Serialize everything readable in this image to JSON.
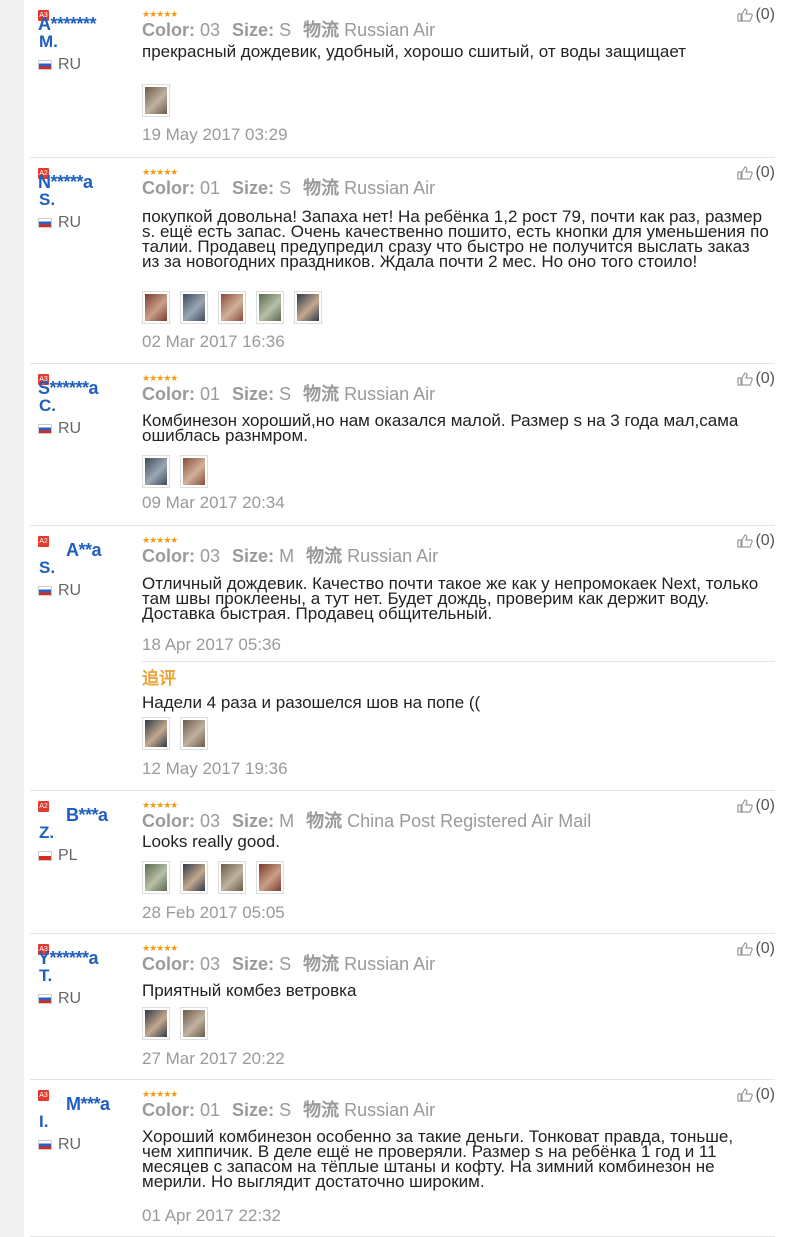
{
  "reviews": [
    {
      "badge": "A3",
      "name": "A*******",
      "initial": "M.",
      "country": "RU",
      "stars": "★★★★★",
      "color_label": "Color:",
      "color": "03",
      "size_label": "Size:",
      "size": "S",
      "logistics_label": "物流",
      "shipping": "Russian Air",
      "comment": "прекрасный дождевик, удобный, хорошо сшитый, от воды защищает",
      "photo_count": 1,
      "date": "19 May 2017 03:29",
      "helpful": "(0)"
    },
    {
      "badge": "A2",
      "name": "N*****a",
      "initial": "S.",
      "country": "RU",
      "stars": "★★★★★",
      "color_label": "Color:",
      "color": "01",
      "size_label": "Size:",
      "size": "S",
      "logistics_label": "物流",
      "shipping": "Russian Air",
      "comment": "покупкой довольна! Запаха нет! На ребёнка 1,2 рост 79, почти как раз, размер s. ещё есть запас. Очень качественно пошито, есть кнопки для уменьшения по талии. Продавец предупредил сразу что быстро не получится выслать заказ из за новогодних праздников. Ждала почти 2 мес. Но оно того стоило!",
      "photo_count": 5,
      "date": "02 Mar 2017 16:36",
      "helpful": "(0)"
    },
    {
      "badge": "A3",
      "name": "S******a",
      "initial": "C.",
      "country": "RU",
      "stars": "★★★★★",
      "color_label": "Color:",
      "color": "01",
      "size_label": "Size:",
      "size": "S",
      "logistics_label": "物流",
      "shipping": "Russian Air",
      "comment": "Комбинезон хороший,но нам оказался малой. Размер s на 3 года мал,сама ошиблась разнмром.",
      "photo_count": 2,
      "date": "09 Mar 2017 20:34",
      "helpful": "(0)"
    },
    {
      "badge": "A2",
      "name": "A**a",
      "initial": "S.",
      "country": "RU",
      "stars": "★★★★★",
      "color_label": "Color:",
      "color": "03",
      "size_label": "Size:",
      "size": "M",
      "logistics_label": "物流",
      "shipping": "Russian Air",
      "comment": "Отличный дождевик. Качество почти такое же как у непромокаек Next, только там швы проклеены, а тут нет. Будет дождь, проверим как держит воду. Доставка быстрая. Продавец общительный.",
      "photo_count": 0,
      "date": "18 Apr 2017 05:36",
      "helpful": "(0)",
      "append_label": "追评",
      "append_text": "Надели 4 раза и разошелся шов на попе ((",
      "append_photo_count": 2,
      "append_date": "12 May 2017 19:36"
    },
    {
      "badge": "A2",
      "name": "B***a",
      "initial": "Z.",
      "country": "PL",
      "stars": "★★★★★",
      "color_label": "Color:",
      "color": "03",
      "size_label": "Size:",
      "size": "M",
      "logistics_label": "物流",
      "shipping": "China Post Registered Air Mail",
      "comment": "Looks really good.",
      "photo_count": 4,
      "date": "28 Feb 2017 05:05",
      "helpful": "(0)"
    },
    {
      "badge": "A3",
      "name": "Y******a",
      "initial": "T.",
      "country": "RU",
      "stars": "★★★★★",
      "color_label": "Color:",
      "color": "03",
      "size_label": "Size:",
      "size": "S",
      "logistics_label": "物流",
      "shipping": "Russian Air",
      "comment": "Приятный комбез ветровка",
      "photo_count": 2,
      "date": "27 Mar 2017 20:22",
      "helpful": "(0)"
    },
    {
      "badge": "A3",
      "name": "M***a",
      "initial": "I.",
      "country": "RU",
      "stars": "★★★★★",
      "color_label": "Color:",
      "color": "01",
      "size_label": "Size:",
      "size": "S",
      "logistics_label": "物流",
      "shipping": "Russian Air",
      "comment": "Хороший комбинезон особенно за такие деньги. Тонковат правда, тоньше, чем хиппичик. В деле ещё не проверяли. Размер s на ребёнка 1 год и 11 месяцев с запасом на тёплые штаны и кофту. На зимний комбинезон не мерили. Но выглядит достаточно широким.",
      "photo_count": 0,
      "date": "01 Apr 2017 22:32",
      "helpful": "(0)"
    }
  ],
  "colors": {
    "name": "#1f5fbf",
    "stars": "#f39c12",
    "muted": "#9a9a9a",
    "append": "#e8a33b",
    "badge": "#e23b2e"
  },
  "icons": {
    "helpful": "thumbs-up-icon"
  }
}
